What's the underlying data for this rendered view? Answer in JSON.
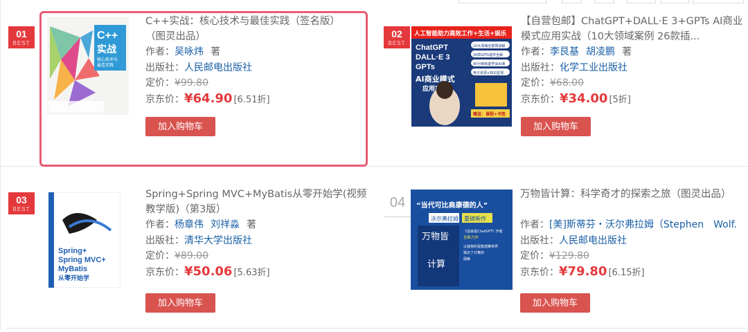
{
  "books": [
    {
      "rank": "01",
      "best": "BEST",
      "title": "C++实战：核心技术与最佳实践（签名版）（图灵出品）",
      "author_label": "作者：",
      "authors": [
        "吴咏炜"
      ],
      "author_suffix": "著",
      "publisher_label": "出版社：",
      "publisher": "人民邮电出版社",
      "list_label": "定价：",
      "list_price": "¥99.80",
      "jd_label": "京东价：",
      "jd_price": "¥64.90",
      "discount": "[6.51折]",
      "cart": "加入购物车",
      "cover": {
        "line1": "C++",
        "line2": "实战",
        "sub1": "核心技术与",
        "sub2": "最佳实践"
      }
    },
    {
      "rank": "02",
      "best": "BEST",
      "title": "【自营包邮】ChatGPT+DALL·E 3+GPTs AI商业模式应用实战（10大领域案例 26款插...",
      "author_label": "作者：",
      "authors": [
        "李艮基",
        "胡凌鹏"
      ],
      "author_suffix": "著",
      "publisher_label": "出版社：",
      "publisher": "化学工业出版社",
      "list_label": "定价：",
      "list_price": "¥68.00",
      "jd_label": "京东价：",
      "jd_price": "¥34.00",
      "discount": "[5折]",
      "cart": "加入购物车",
      "cover": {
        "banner": "人工智能助力高效工作+生活+娱乐",
        "t1": "ChatGPT",
        "t2": "DALL·E 3",
        "t3": "GPTs",
        "t4": "AI商业模式",
        "t5": "应用实战",
        "bullets": [
          "10大领域全案例讲解",
          "26款GPTs插件全解",
          "90分钟就能学会AI课",
          "电子资源+知识星球"
        ],
        "tag": "赠送：课程+书签"
      }
    },
    {
      "rank": "03",
      "best": "BEST",
      "title": "Spring+Spring MVC+MyBatis从零开始学(视频教学版)（第3版）",
      "author_label": "作者：",
      "authors": [
        "杨章伟",
        "刘祥淼"
      ],
      "author_suffix": "著",
      "publisher_label": "出版社：",
      "publisher": "清华大学出版社",
      "list_label": "定价：",
      "list_price": "¥89.00",
      "jd_label": "京东价：",
      "jd_price": "¥50.06",
      "discount": "[5.63折]",
      "cart": "加入购物车",
      "cover": {
        "t1": "Spring+",
        "t2": "Spring MVC+",
        "t3": "MyBatis",
        "t4": "从零开始学"
      }
    },
    {
      "rank": "04",
      "best": "",
      "title": "万物皆计算：科学奇才的探索之旅（图灵出品）",
      "author_label": "作者：",
      "authors": [
        "[美]斯蒂芬・沃尔弗拉姆（Stephen　Wolf..."
      ],
      "author_suffix": "",
      "publisher_label": "出版社：",
      "publisher": "人民邮电出版社",
      "list_label": "定价：",
      "list_price": "¥129.80",
      "jd_label": "京东价：",
      "jd_price": "¥79.80",
      "discount": "[6.15折]",
      "cart": "加入购物车",
      "cover": {
        "quote": "“当代可比肩康德的人”",
        "author": "沃尔弗拉姆",
        "tag": "重磅新作",
        "t1": "万物皆",
        "t2": "计算",
        "lines": [
          "《这就是ChatGPT》作者",
          "全新力作",
          "以独特的视角观察世界",
          "揭示了计算的",
          "探索"
        ]
      }
    }
  ],
  "colors": {
    "accent": "#e4393c",
    "link": "#1a5fa6",
    "highlight": "#e85b74"
  }
}
